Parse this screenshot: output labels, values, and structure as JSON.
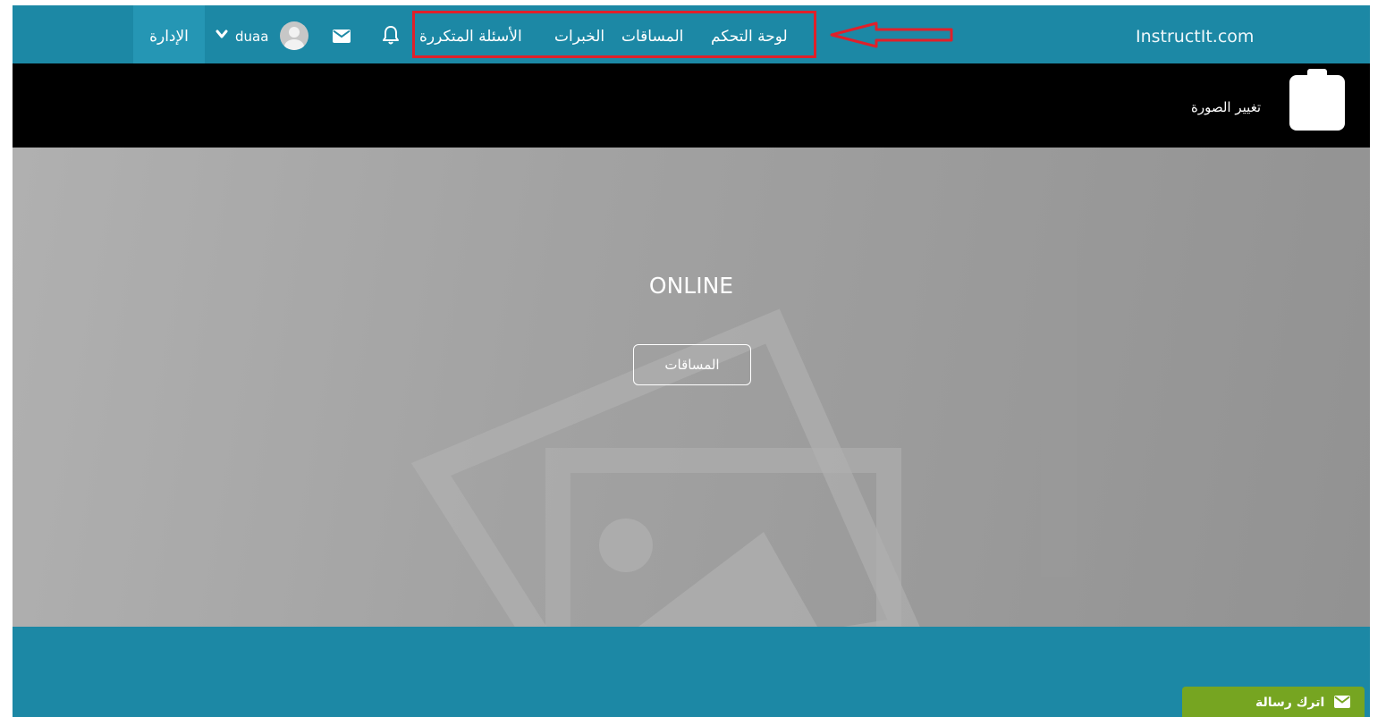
{
  "header": {
    "brand": "InstructIt.com",
    "nav": {
      "dashboard": "لوحة التحكم",
      "contests": "المساقات",
      "experiences": "الخبرات",
      "faq": "الأسئلة المتكررة"
    },
    "username": "duaa",
    "admin_label": "الإدارة"
  },
  "profile_bar": {
    "change_photo_label": "تغيير الصورة"
  },
  "hero": {
    "title": "ONLINE",
    "button_label": "المساقات"
  },
  "footer": {
    "leave_message_label": "اترك رسالة"
  },
  "colors": {
    "header_bg": "#1c88a5",
    "highlight_border": "#e0202a",
    "leave_message_bg": "#76a521"
  }
}
